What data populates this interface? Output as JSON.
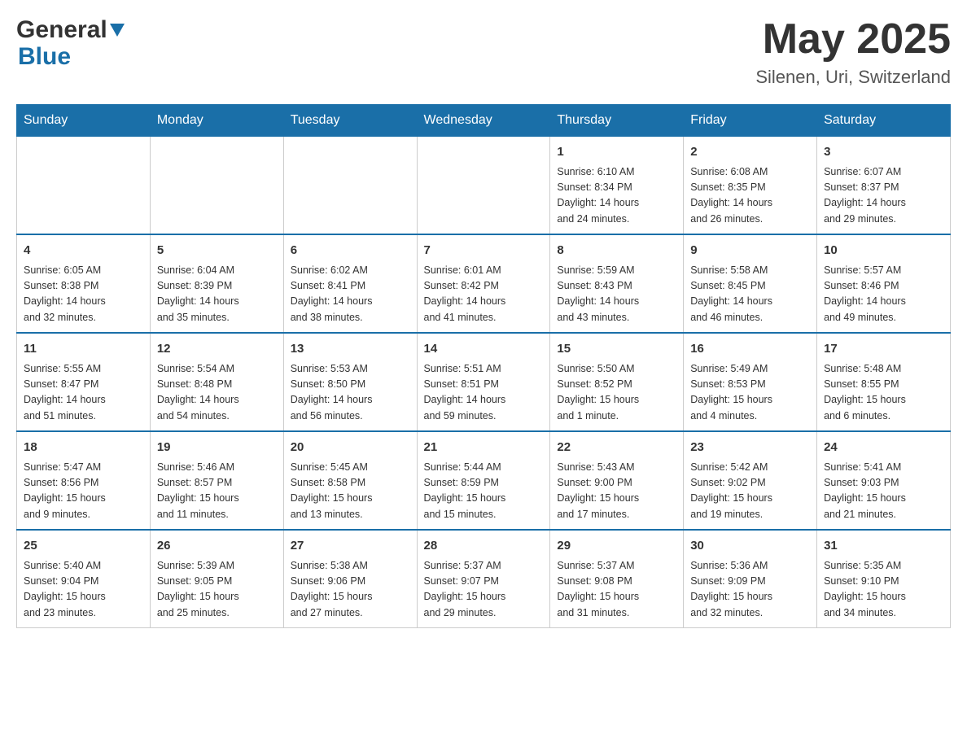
{
  "header": {
    "logo_general": "General",
    "logo_blue": "Blue",
    "month_year": "May 2025",
    "location": "Silenen, Uri, Switzerland"
  },
  "weekdays": [
    "Sunday",
    "Monday",
    "Tuesday",
    "Wednesday",
    "Thursday",
    "Friday",
    "Saturday"
  ],
  "weeks": [
    {
      "days": [
        {
          "number": "",
          "info": ""
        },
        {
          "number": "",
          "info": ""
        },
        {
          "number": "",
          "info": ""
        },
        {
          "number": "",
          "info": ""
        },
        {
          "number": "1",
          "info": "Sunrise: 6:10 AM\nSunset: 8:34 PM\nDaylight: 14 hours\nand 24 minutes."
        },
        {
          "number": "2",
          "info": "Sunrise: 6:08 AM\nSunset: 8:35 PM\nDaylight: 14 hours\nand 26 minutes."
        },
        {
          "number": "3",
          "info": "Sunrise: 6:07 AM\nSunset: 8:37 PM\nDaylight: 14 hours\nand 29 minutes."
        }
      ]
    },
    {
      "days": [
        {
          "number": "4",
          "info": "Sunrise: 6:05 AM\nSunset: 8:38 PM\nDaylight: 14 hours\nand 32 minutes."
        },
        {
          "number": "5",
          "info": "Sunrise: 6:04 AM\nSunset: 8:39 PM\nDaylight: 14 hours\nand 35 minutes."
        },
        {
          "number": "6",
          "info": "Sunrise: 6:02 AM\nSunset: 8:41 PM\nDaylight: 14 hours\nand 38 minutes."
        },
        {
          "number": "7",
          "info": "Sunrise: 6:01 AM\nSunset: 8:42 PM\nDaylight: 14 hours\nand 41 minutes."
        },
        {
          "number": "8",
          "info": "Sunrise: 5:59 AM\nSunset: 8:43 PM\nDaylight: 14 hours\nand 43 minutes."
        },
        {
          "number": "9",
          "info": "Sunrise: 5:58 AM\nSunset: 8:45 PM\nDaylight: 14 hours\nand 46 minutes."
        },
        {
          "number": "10",
          "info": "Sunrise: 5:57 AM\nSunset: 8:46 PM\nDaylight: 14 hours\nand 49 minutes."
        }
      ]
    },
    {
      "days": [
        {
          "number": "11",
          "info": "Sunrise: 5:55 AM\nSunset: 8:47 PM\nDaylight: 14 hours\nand 51 minutes."
        },
        {
          "number": "12",
          "info": "Sunrise: 5:54 AM\nSunset: 8:48 PM\nDaylight: 14 hours\nand 54 minutes."
        },
        {
          "number": "13",
          "info": "Sunrise: 5:53 AM\nSunset: 8:50 PM\nDaylight: 14 hours\nand 56 minutes."
        },
        {
          "number": "14",
          "info": "Sunrise: 5:51 AM\nSunset: 8:51 PM\nDaylight: 14 hours\nand 59 minutes."
        },
        {
          "number": "15",
          "info": "Sunrise: 5:50 AM\nSunset: 8:52 PM\nDaylight: 15 hours\nand 1 minute."
        },
        {
          "number": "16",
          "info": "Sunrise: 5:49 AM\nSunset: 8:53 PM\nDaylight: 15 hours\nand 4 minutes."
        },
        {
          "number": "17",
          "info": "Sunrise: 5:48 AM\nSunset: 8:55 PM\nDaylight: 15 hours\nand 6 minutes."
        }
      ]
    },
    {
      "days": [
        {
          "number": "18",
          "info": "Sunrise: 5:47 AM\nSunset: 8:56 PM\nDaylight: 15 hours\nand 9 minutes."
        },
        {
          "number": "19",
          "info": "Sunrise: 5:46 AM\nSunset: 8:57 PM\nDaylight: 15 hours\nand 11 minutes."
        },
        {
          "number": "20",
          "info": "Sunrise: 5:45 AM\nSunset: 8:58 PM\nDaylight: 15 hours\nand 13 minutes."
        },
        {
          "number": "21",
          "info": "Sunrise: 5:44 AM\nSunset: 8:59 PM\nDaylight: 15 hours\nand 15 minutes."
        },
        {
          "number": "22",
          "info": "Sunrise: 5:43 AM\nSunset: 9:00 PM\nDaylight: 15 hours\nand 17 minutes."
        },
        {
          "number": "23",
          "info": "Sunrise: 5:42 AM\nSunset: 9:02 PM\nDaylight: 15 hours\nand 19 minutes."
        },
        {
          "number": "24",
          "info": "Sunrise: 5:41 AM\nSunset: 9:03 PM\nDaylight: 15 hours\nand 21 minutes."
        }
      ]
    },
    {
      "days": [
        {
          "number": "25",
          "info": "Sunrise: 5:40 AM\nSunset: 9:04 PM\nDaylight: 15 hours\nand 23 minutes."
        },
        {
          "number": "26",
          "info": "Sunrise: 5:39 AM\nSunset: 9:05 PM\nDaylight: 15 hours\nand 25 minutes."
        },
        {
          "number": "27",
          "info": "Sunrise: 5:38 AM\nSunset: 9:06 PM\nDaylight: 15 hours\nand 27 minutes."
        },
        {
          "number": "28",
          "info": "Sunrise: 5:37 AM\nSunset: 9:07 PM\nDaylight: 15 hours\nand 29 minutes."
        },
        {
          "number": "29",
          "info": "Sunrise: 5:37 AM\nSunset: 9:08 PM\nDaylight: 15 hours\nand 31 minutes."
        },
        {
          "number": "30",
          "info": "Sunrise: 5:36 AM\nSunset: 9:09 PM\nDaylight: 15 hours\nand 32 minutes."
        },
        {
          "number": "31",
          "info": "Sunrise: 5:35 AM\nSunset: 9:10 PM\nDaylight: 15 hours\nand 34 minutes."
        }
      ]
    }
  ]
}
